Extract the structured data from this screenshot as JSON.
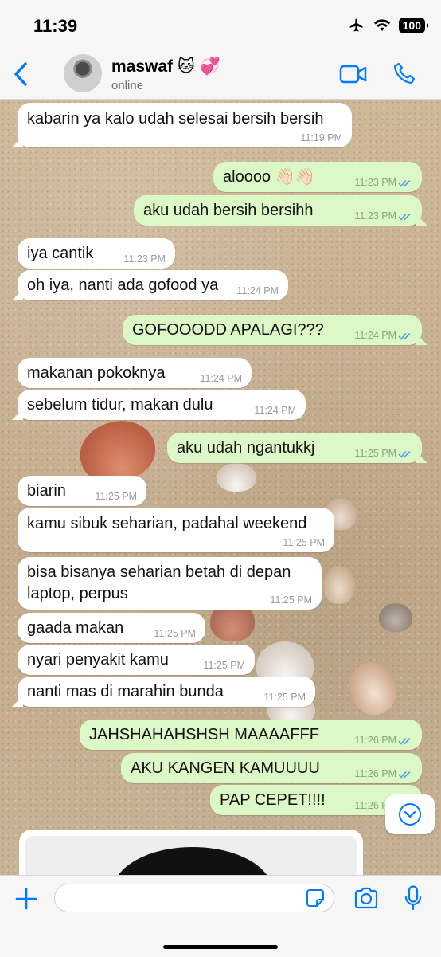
{
  "status_bar": {
    "time": "11:39",
    "battery": "100"
  },
  "header": {
    "name": "maswaf 🐱 💞",
    "status": "online"
  },
  "input": {
    "placeholder": ""
  },
  "messages": [
    {
      "dir": "in",
      "text": "kabarin ya kalo udah selesai bersih bersih",
      "time": "11:19 PM"
    },
    {
      "dir": "out",
      "text": "aloooo 👋🏻👋🏻",
      "time": "11:23 PM"
    },
    {
      "dir": "out",
      "text": "aku udah bersih bersihh",
      "time": "11:23 PM"
    },
    {
      "dir": "in",
      "text": "iya cantik",
      "time": "11:23 PM"
    },
    {
      "dir": "in",
      "text": "oh iya, nanti ada gofood ya",
      "time": "11:24 PM"
    },
    {
      "dir": "out",
      "text": "GOFOOODD APALAGI???",
      "time": "11:24 PM"
    },
    {
      "dir": "in",
      "text": "makanan pokoknya",
      "time": "11:24 PM"
    },
    {
      "dir": "in",
      "text": "sebelum tidur, makan dulu",
      "time": "11:24 PM"
    },
    {
      "dir": "out",
      "text": "aku udah ngantukkj",
      "time": "11:25 PM"
    },
    {
      "dir": "in",
      "text": "biarin",
      "time": "11:25 PM"
    },
    {
      "dir": "in",
      "text": "kamu sibuk seharian, padahal weekend",
      "time": "11:25 PM"
    },
    {
      "dir": "in",
      "text": "bisa bisanya seharian betah di depan laptop, perpus",
      "time": "11:25 PM"
    },
    {
      "dir": "in",
      "text": "gaada makan",
      "time": "11:25 PM"
    },
    {
      "dir": "in",
      "text": "nyari penyakit kamu",
      "time": "11:25 PM"
    },
    {
      "dir": "in",
      "text": "nanti mas di marahin bunda",
      "time": "11:25 PM"
    },
    {
      "dir": "out",
      "text": "JAHSHAHAHSHSH MAAAAFFF",
      "time": "11:26 PM"
    },
    {
      "dir": "out",
      "text": "AKU KANGEN KAMUUUU",
      "time": "11:26 PM"
    },
    {
      "dir": "out",
      "text": "PAP CEPET!!!!",
      "time": "11:26 PM"
    }
  ],
  "colors": {
    "accent": "#007aff",
    "outgoing": "#dcf8c6",
    "incoming": "#ffffff",
    "read_ticks": "#4fa3e0"
  }
}
